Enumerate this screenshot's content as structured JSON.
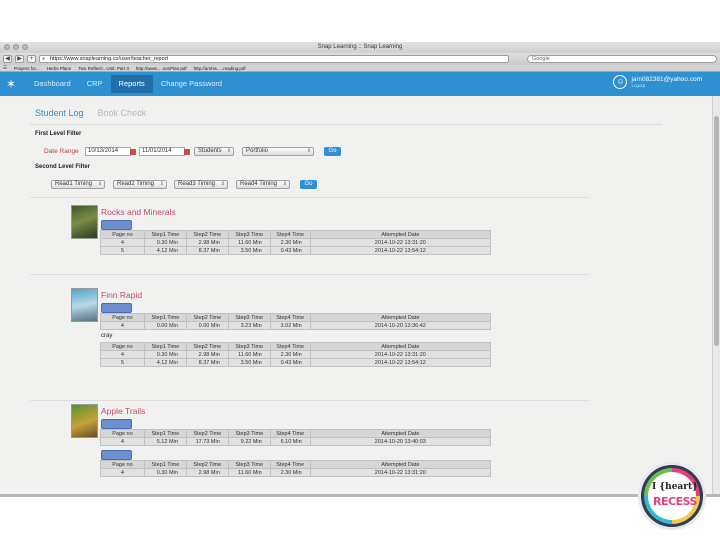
{
  "browser": {
    "window_title": "Snap Learning :: Snap Learning",
    "url": "https://www.snaplearning.co/user/teacher_report",
    "search_placeholder": "Google",
    "bookmarks": [
      "Prayers for...",
      "Herbs Place",
      "Two Reflecti...Unit: Part 3",
      "http://www.....sonPlan.pdf",
      "http://amhis.....reading.pdf"
    ]
  },
  "appnav": {
    "items": [
      "Dashboard",
      "CRP",
      "Reports",
      "Change Password"
    ],
    "active_index": 2,
    "user_email": "jam082381@yahoo.com",
    "logout_label": "Logout"
  },
  "tabs": [
    "Student Log",
    "Book Check"
  ],
  "first_filter": {
    "title": "First Level Filter",
    "date_label": "Date Range",
    "date_from": "10/13/2014",
    "date_to": "11/01/2014",
    "students": "Students",
    "portfolio": "Portfolio",
    "go": "Go"
  },
  "second_filter": {
    "title": "Second Level Filter",
    "selects": [
      "Read1 Timing",
      "Read2 Timing",
      "Read3 Timing",
      "Read4 Timing"
    ],
    "go": "Go"
  },
  "table_headers": [
    "Page no",
    "Step1 Time",
    "Step2 Time",
    "Step3 Time",
    "Step4 Time",
    "Attempted Date"
  ],
  "books": [
    {
      "title": "Rocks and Minerals",
      "tables": [
        {
          "rows": [
            [
              "4",
              "0.30 Min",
              "2.98 Min",
              "11.60 Min",
              "2.30 Min",
              "2014-10-22 13:31:20"
            ],
            [
              "5",
              "4.12 Min",
              "8.37 Min",
              "3.50 Min",
              "0.43 Min",
              "2014-10-22 13:54:12"
            ]
          ]
        }
      ]
    },
    {
      "title": "Finn Rapid",
      "tables": [
        {
          "rows": [
            [
              "4",
              "0.00 Min",
              "0.00 Min",
              "3.23 Min",
              "3.02 Min",
              "2014-10-20 13:36:42"
            ]
          ]
        },
        {
          "note": "cray",
          "rows": [
            [
              "4",
              "0.30 Min",
              "2.98 Min",
              "11.60 Min",
              "2.30 Min",
              "2014-10-22 13:31:20"
            ],
            [
              "5",
              "4.12 Min",
              "8.37 Min",
              "3.50 Min",
              "0.43 Min",
              "2014-10-22 13:54:12"
            ]
          ]
        }
      ]
    },
    {
      "title": "Apple Trails",
      "tables": [
        {
          "rows": [
            [
              "4",
              "5.12 Min",
              "17.73 Min",
              "9.22 Min",
              "6.10 Min",
              "2014-10-20 13:40:03"
            ]
          ]
        },
        {
          "rows": [
            [
              "4",
              "0.30 Min",
              "2.98 Min",
              "11.60 Min",
              "2.30 Min",
              "2014-10-22 13:31:20"
            ]
          ]
        }
      ]
    }
  ],
  "badge": {
    "line1": "I {heart}",
    "line2": "RECESS"
  },
  "colors": {
    "nav_blue": "#2e8fd1",
    "title_pink": "#c04a6a",
    "label_red": "#b04545"
  }
}
